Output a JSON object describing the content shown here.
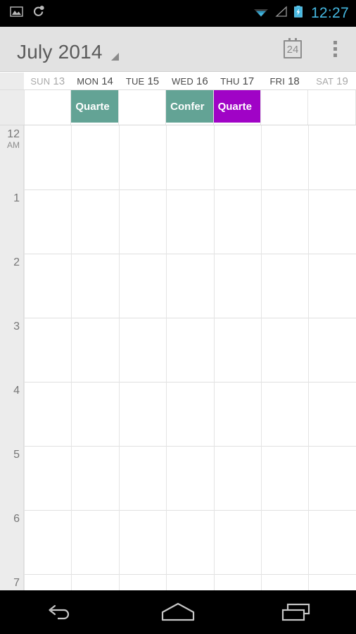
{
  "status_bar": {
    "left_icons": [
      {
        "name": "screenshot-image-icon",
        "glyph": "image"
      },
      {
        "name": "sync-icon",
        "glyph": "sync"
      }
    ],
    "right_icons": [
      {
        "name": "wifi-icon",
        "glyph": "wifi"
      },
      {
        "name": "cell-signal-icon",
        "glyph": "signal"
      },
      {
        "name": "battery-charging-icon",
        "glyph": "battery"
      }
    ],
    "clock": "12:27",
    "clock_color": "#45b7e0",
    "background": "#000000"
  },
  "action_bar": {
    "title": "July 2014",
    "spinner_name": "view-spinner-triangle",
    "today_button_label": "24",
    "today_button_name": "go-to-today-button",
    "overflow_label": "More options",
    "background": "#e2e2e2",
    "text_color": "#5a5a5a"
  },
  "calendar": {
    "view": "week",
    "days": [
      {
        "dow": "SUN",
        "date": "13",
        "weekend": true
      },
      {
        "dow": "MON",
        "date": "14",
        "weekend": false
      },
      {
        "dow": "TUE",
        "date": "15",
        "weekend": false
      },
      {
        "dow": "WED",
        "date": "16",
        "weekend": false
      },
      {
        "dow": "THU",
        "date": "17",
        "weekend": false
      },
      {
        "dow": "FRI",
        "date": "18",
        "weekend": false
      },
      {
        "dow": "SAT",
        "date": "19",
        "weekend": true
      }
    ],
    "all_day_events": [
      {
        "title": "Quarte",
        "day_index": 1,
        "color": "#63a395"
      },
      {
        "title": "Confer",
        "day_index": 3,
        "color": "#63a395"
      },
      {
        "title": "Quarte",
        "day_index": 4,
        "color": "#a003c6"
      }
    ],
    "hours": [
      {
        "label": "12",
        "ampm": "AM"
      },
      {
        "label": "1",
        "ampm": ""
      },
      {
        "label": "2",
        "ampm": ""
      },
      {
        "label": "3",
        "ampm": ""
      },
      {
        "label": "4",
        "ampm": ""
      },
      {
        "label": "5",
        "ampm": ""
      },
      {
        "label": "6",
        "ampm": ""
      },
      {
        "label": "7",
        "ampm": ""
      }
    ],
    "gutter_color": "#ececec",
    "grid_line_color": "#e0e0e0",
    "grid_background": "#ffffff"
  },
  "nav_bar": {
    "buttons": [
      {
        "name": "back-button",
        "label": "Back"
      },
      {
        "name": "home-button",
        "label": "Home"
      },
      {
        "name": "recents-button",
        "label": "Recent apps"
      }
    ],
    "background": "#000000"
  }
}
